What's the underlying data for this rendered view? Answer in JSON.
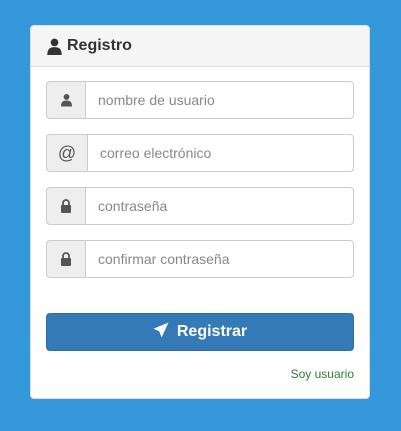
{
  "panel": {
    "title": "Registro",
    "title_icon": "user-icon"
  },
  "form": {
    "username": {
      "icon": "user-icon",
      "placeholder": "nombre de usuario",
      "value": ""
    },
    "email": {
      "icon": "at-sign-icon",
      "icon_text": "@",
      "placeholder": "correo electrónico",
      "value": ""
    },
    "password": {
      "icon": "lock-icon",
      "placeholder": "contraseña",
      "value": ""
    },
    "confirm_password": {
      "icon": "lock-icon",
      "placeholder": "confirmar contraseña",
      "value": ""
    },
    "submit_label": "Registrar",
    "submit_icon": "send-icon",
    "login_link": "Soy usuario"
  },
  "colors": {
    "background": "#3498db",
    "primary": "#337ab7",
    "link": "#2e7d32"
  }
}
